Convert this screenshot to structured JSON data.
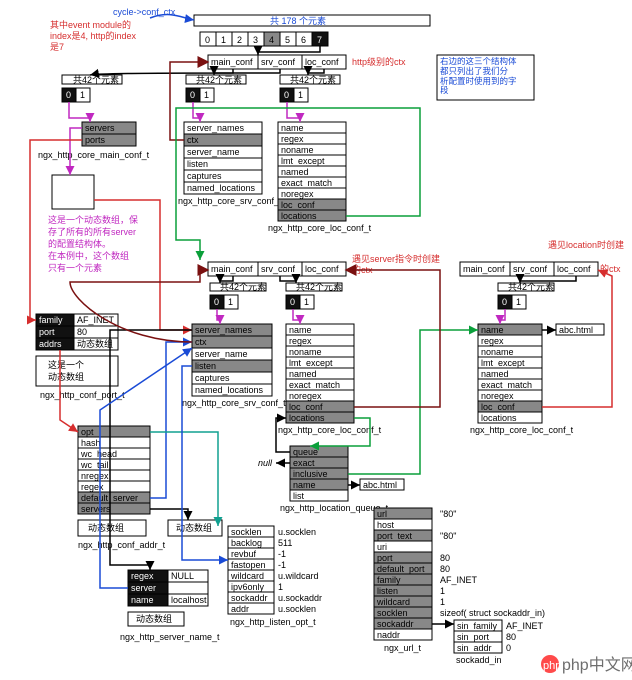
{
  "header": {
    "cycle_conf": "cycle->conf_ctx",
    "note_red": "其中event module的\nindex是4, http的index\n是7",
    "count178_pre": "共 ",
    "count178_n": "178",
    "count178_post": " 个元素",
    "idx": [
      "0",
      "1",
      "2",
      "3",
      "4",
      "5",
      "6",
      "7"
    ],
    "note_blue": "右边的这三个结构体\n都只列出了我们分\n析配置时使用到的字\n段"
  },
  "counts": {
    "c42": "共42个元素",
    "c01a": "0",
    "c01b": "1"
  },
  "ctx_row": {
    "main": "main_conf",
    "srv": "srv_conf",
    "loc": "loc_conf",
    "http_level": "http级别的ctx",
    "server_level_pre": "遇见server指令时创建",
    "server_level": "的ctx",
    "loc_level_pre": "遇见location时创建",
    "loc_level": "的ctx"
  },
  "main_block": {
    "row1": "servers",
    "row2": "ports",
    "caption": "ngx_http_core_main_conf_t"
  },
  "srv_block": {
    "r": [
      "server_names",
      "ctx",
      "server_name",
      "listen",
      "captures",
      "named_locations"
    ],
    "caption": "ngx_http_core_srv_conf_t"
  },
  "loc_block": {
    "r": [
      "name",
      "regex",
      "noname",
      "lmt_except",
      "named",
      "exact_match",
      "noregex",
      "loc_conf",
      "locations"
    ],
    "caption": "ngx_http_core_loc_conf_t"
  },
  "magenta_note": {
    "l1": "这是一个动态数组，保",
    "l2": "存了所有的所有server",
    "l3": "的配置结构体。",
    "l4": "在本例中，这个数组",
    "l5": "只有一个元素"
  },
  "magenta_box": {
    "a": "",
    "b": ""
  },
  "port_block": {
    "col1": [
      "family",
      "port",
      "addrs"
    ],
    "col2": [
      "AF_INET",
      "80",
      "动态数组"
    ],
    "note1": "这是一个",
    "note2": "动态数组",
    "caption": "ngx_http_conf_port_t"
  },
  "addr_block": {
    "r": [
      "opt",
      "hash",
      "wc_head",
      "wc_tail",
      "nregex",
      "regex",
      "default_server",
      "servers"
    ],
    "foot": "动态数组",
    "foot2": "动态数组",
    "caption": "ngx_http_conf_addr_t"
  },
  "servername_block": {
    "col1": [
      "regex",
      "server",
      "name"
    ],
    "col2": [
      "NULL",
      "",
      "localhost"
    ],
    "foot": "动态数组",
    "caption": "ngx_http_server_name_t"
  },
  "queue_block": {
    "r": [
      "queue",
      "exact",
      "inclusive",
      "name",
      "list"
    ],
    "null": "null",
    "side": "abc.html",
    "caption": "ngx_http_location_queue_t"
  },
  "listenopt_block": {
    "col1": [
      "socklen",
      "backlog",
      "revbuf",
      "fastopen",
      "wildcard",
      "ipv6only",
      "sockaddr",
      "addr"
    ],
    "col2": [
      "u.socklen",
      "511",
      "-1",
      "-1",
      "u.wildcard",
      "1",
      "u.sockaddr",
      "u.socklen"
    ],
    "caption": "ngx_http_listen_opt_t"
  },
  "url_block": {
    "col1": [
      "url",
      "host",
      "port_text",
      "uri",
      "port",
      "default_port",
      "family",
      "listen",
      "wildcard",
      "socklen",
      "sockaddr",
      "naddr"
    ],
    "col2": [
      "\"80\"",
      "",
      "\"80\"",
      "",
      "80",
      "80",
      "AF_INET",
      "1",
      "1",
      "sizeof( struct sockaddr_in)",
      "",
      ""
    ],
    "sub_col1": [
      "sin_family",
      "sin_port",
      "sin_addr"
    ],
    "sub_col2": [
      "AF_INET",
      "80",
      "0"
    ],
    "sub_caption": "sockadd_in",
    "caption": "ngx_url_t"
  },
  "loc_block2": {
    "r": [
      "name",
      "regex",
      "noname",
      "lmt_except",
      "named",
      "exact_match",
      "noregex",
      "loc_conf",
      "locations"
    ],
    "side": "abc.html",
    "caption": "ngx_http_core_loc_conf_t"
  },
  "watermark": "php中文网"
}
